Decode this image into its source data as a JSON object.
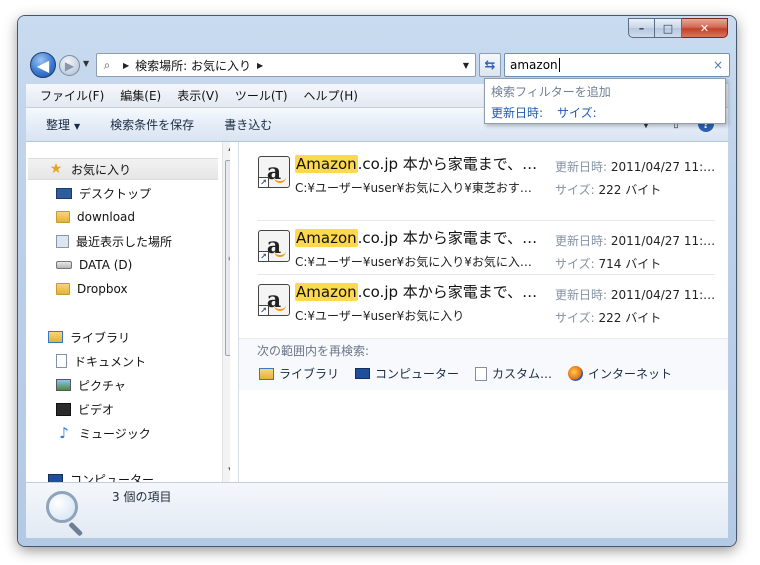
{
  "window": {
    "caption": {
      "minimize": "–",
      "maximize": "□",
      "close": "✕"
    }
  },
  "nav": {
    "back": "◀",
    "forward": "▶",
    "address_text": "検索場所: お気に入り",
    "refresh": "⇆"
  },
  "search": {
    "value": "amazon",
    "clear": "×",
    "suggest_title": "検索フィルターを追加",
    "suggest_links": [
      "更新日時:",
      "サイズ:"
    ]
  },
  "menubar": {
    "items": [
      "ファイル(F)",
      "編集(E)",
      "表示(V)",
      "ツール(T)",
      "ヘルプ(H)"
    ]
  },
  "cmdbar": {
    "organize": "整理",
    "save_search": "検索条件を保存",
    "burn": "書き込む"
  },
  "sidebar": {
    "favorites_header": "お気に入り",
    "favorites": [
      "デスクトップ",
      "download",
      "最近表示した場所",
      "DATA (D)",
      "Dropbox"
    ],
    "libraries_header": "ライブラリ",
    "libraries": [
      "ドキュメント",
      "ピクチャ",
      "ビデオ",
      "ミュージック"
    ],
    "computer_header": "コンピューター"
  },
  "results": [
    {
      "highlight": "Amazon",
      "title_rest": ".co.jp 本から家電まで、…",
      "path": "C:¥ユーザー¥user¥お気に入り¥東芝おす…",
      "date_label": "更新日時:",
      "date": "2011/04/27 11:…",
      "size_label": "サイズ:",
      "size": "222 バイト"
    },
    {
      "highlight": "Amazon",
      "title_rest": ".co.jp 本から家電まで、…",
      "path": "C:¥ユーザー¥user¥お気に入り¥お気に入…",
      "date_label": "更新日時:",
      "date": "2011/04/27 11:…",
      "size_label": "サイズ:",
      "size": "714 バイト"
    },
    {
      "highlight": "Amazon",
      "title_rest": ".co.jp 本から家電まで、…",
      "path": "C:¥ユーザー¥user¥お気に入り",
      "date_label": "更新日時:",
      "date": "2011/04/27 11:…",
      "size_label": "サイズ:",
      "size": "222 バイト"
    }
  ],
  "search_again": {
    "label": "次の範囲内を再検索:",
    "items": [
      "ライブラリ",
      "コンピューター",
      "カスタム…",
      "インターネット"
    ]
  },
  "details": {
    "item_count": "3 個の項目"
  },
  "colors": {
    "highlight": "#ffd84d",
    "link": "#1d5ab5"
  }
}
